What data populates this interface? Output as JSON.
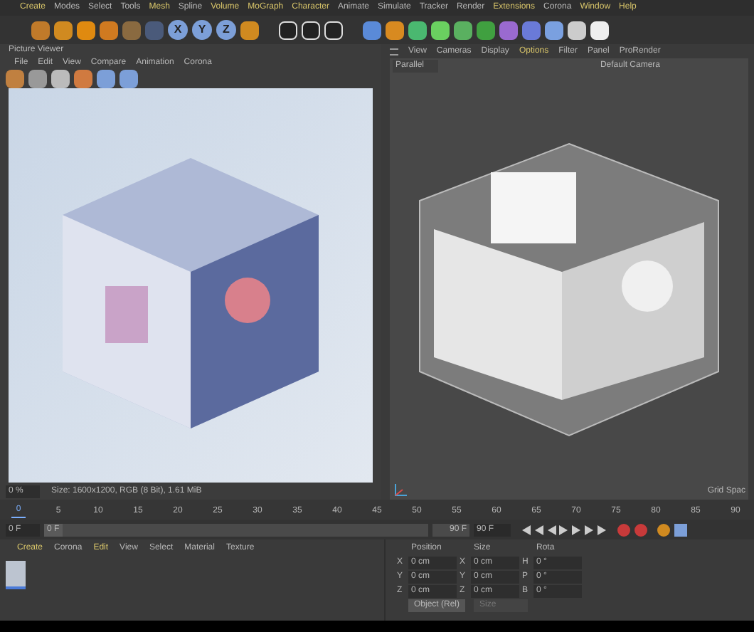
{
  "main_menu": [
    {
      "label": "Create",
      "highlighted": true
    },
    {
      "label": "Modes",
      "highlighted": false
    },
    {
      "label": "Select",
      "highlighted": false
    },
    {
      "label": "Tools",
      "highlighted": false
    },
    {
      "label": "Mesh",
      "highlighted": true
    },
    {
      "label": "Spline",
      "highlighted": false
    },
    {
      "label": "Volume",
      "highlighted": true
    },
    {
      "label": "MoGraph",
      "highlighted": true
    },
    {
      "label": "Character",
      "highlighted": true
    },
    {
      "label": "Animate",
      "highlighted": false
    },
    {
      "label": "Simulate",
      "highlighted": false
    },
    {
      "label": "Tracker",
      "highlighted": false
    },
    {
      "label": "Render",
      "highlighted": false
    },
    {
      "label": "Extensions",
      "highlighted": true
    },
    {
      "label": "Corona",
      "highlighted": false
    },
    {
      "label": "Window",
      "highlighted": true
    },
    {
      "label": "Help",
      "highlighted": true
    }
  ],
  "axis_buttons": [
    {
      "label": "X",
      "selected": true
    },
    {
      "label": "Y",
      "selected": true
    },
    {
      "label": "Z",
      "selected": true
    }
  ],
  "picture_viewer": {
    "title": "Picture Viewer",
    "menu": [
      "File",
      "Edit",
      "View",
      "Compare",
      "Animation",
      "Corona"
    ],
    "zoom": "0 %",
    "info": "Size: 1600x1200, RGB (8 Bit), 1.61 MiB"
  },
  "viewport": {
    "menu": [
      {
        "label": "View",
        "highlighted": false
      },
      {
        "label": "Cameras",
        "highlighted": false
      },
      {
        "label": "Display",
        "highlighted": false
      },
      {
        "label": "Options",
        "highlighted": true
      },
      {
        "label": "Filter",
        "highlighted": false
      },
      {
        "label": "Panel",
        "highlighted": false
      },
      {
        "label": "ProRender",
        "highlighted": false
      }
    ],
    "projection": "Parallel",
    "camera": "Default Camera",
    "grid": "Grid Spac"
  },
  "timeline": {
    "ticks": [
      {
        "label": "0",
        "selected": true
      },
      {
        "label": "5",
        "selected": false
      },
      {
        "label": "10",
        "selected": false
      },
      {
        "label": "15",
        "selected": false
      },
      {
        "label": "20",
        "selected": false
      },
      {
        "label": "25",
        "selected": false
      },
      {
        "label": "30",
        "selected": false
      },
      {
        "label": "35",
        "selected": false
      },
      {
        "label": "40",
        "selected": false
      },
      {
        "label": "45",
        "selected": false
      },
      {
        "label": "50",
        "selected": false
      },
      {
        "label": "55",
        "selected": false
      },
      {
        "label": "60",
        "selected": false
      },
      {
        "label": "65",
        "selected": false
      },
      {
        "label": "70",
        "selected": false
      },
      {
        "label": "75",
        "selected": false
      },
      {
        "label": "80",
        "selected": false
      },
      {
        "label": "85",
        "selected": false
      },
      {
        "label": "90",
        "selected": false
      }
    ],
    "start": "0 F",
    "current": "0 F",
    "level": 0,
    "end": "90 F",
    "max": "90 F"
  },
  "material_menu": [
    {
      "label": "Create",
      "highlighted": true
    },
    {
      "label": "Corona",
      "highlighted": false
    },
    {
      "label": "Edit",
      "highlighted": true
    },
    {
      "label": "View",
      "highlighted": false
    },
    {
      "label": "Select",
      "highlighted": false
    },
    {
      "label": "Material",
      "highlighted": false
    },
    {
      "label": "Texture",
      "highlighted": false
    }
  ],
  "attributes": {
    "columns": [
      "Position",
      "Size",
      "Rota"
    ],
    "rows": [
      [
        {
          "axis": "X",
          "value": "0 cm"
        },
        {
          "axis": "X",
          "value": "0 cm"
        },
        {
          "axis": "H",
          "value": "0 °"
        }
      ],
      [
        {
          "axis": "Y",
          "value": "0 cm"
        },
        {
          "axis": "Y",
          "value": "0 cm"
        },
        {
          "axis": "P",
          "value": "0 °"
        }
      ],
      [
        {
          "axis": "Z",
          "value": "0 cm"
        },
        {
          "axis": "Z",
          "value": "0 cm"
        },
        {
          "axis": "B",
          "value": "0 °"
        }
      ]
    ],
    "mode": "Object (Rel)",
    "size_mode": "Size"
  }
}
